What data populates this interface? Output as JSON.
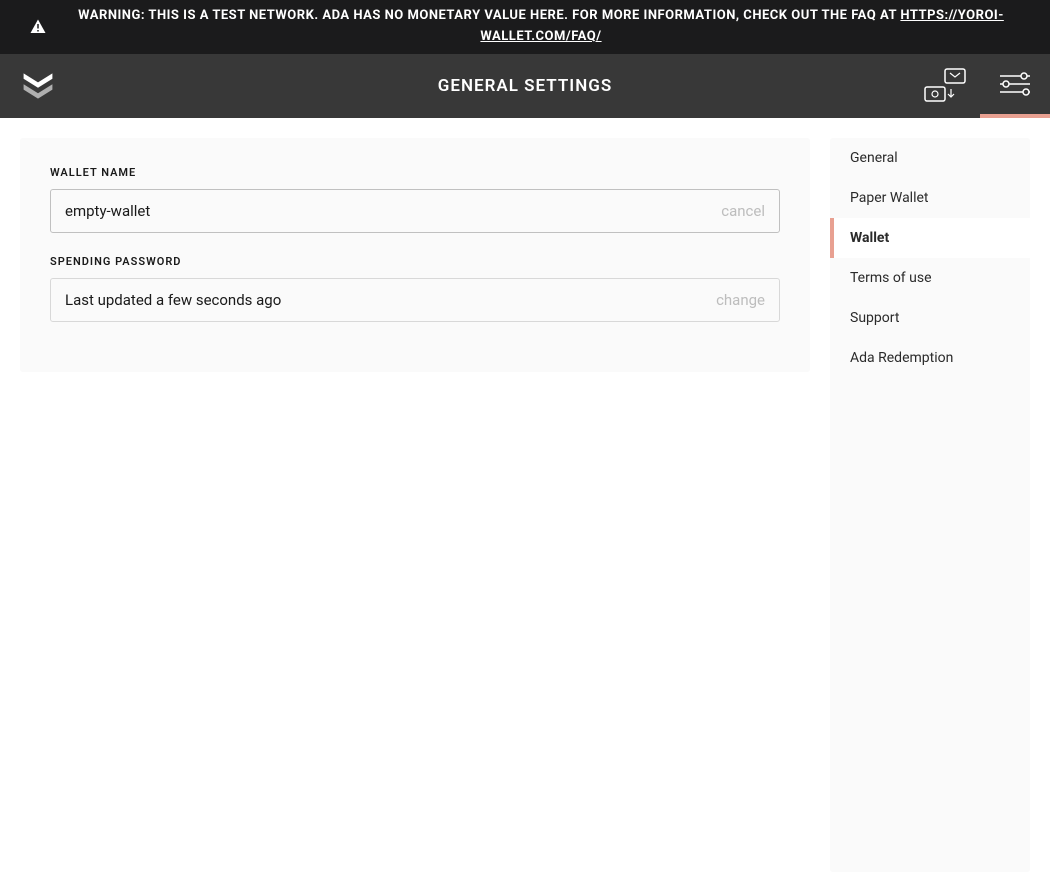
{
  "warning": {
    "text": "WARNING: THIS IS A TEST NETWORK. ADA HAS NO MONETARY VALUE HERE. FOR MORE INFORMATION, CHECK OUT THE FAQ AT ",
    "link_text": "HTTPS://YOROI-WALLET.COM/FAQ/"
  },
  "header": {
    "title": "GENERAL SETTINGS"
  },
  "fields": {
    "wallet_name": {
      "label": "WALLET NAME",
      "value": "empty-wallet",
      "action": "cancel"
    },
    "spending_password": {
      "label": "SPENDING PASSWORD",
      "value": "Last updated a few seconds ago",
      "action": "change"
    }
  },
  "sidebar": {
    "items": [
      {
        "label": "General",
        "active": false
      },
      {
        "label": "Paper Wallet",
        "active": false
      },
      {
        "label": "Wallet",
        "active": true
      },
      {
        "label": "Terms of use",
        "active": false
      },
      {
        "label": "Support",
        "active": false
      },
      {
        "label": "Ada Redemption",
        "active": false
      }
    ]
  },
  "colors": {
    "accent1": "#e8a091",
    "dark_bg": "#383838",
    "banner_bg": "#1b1b1c",
    "panel_bg": "#fafafa"
  }
}
